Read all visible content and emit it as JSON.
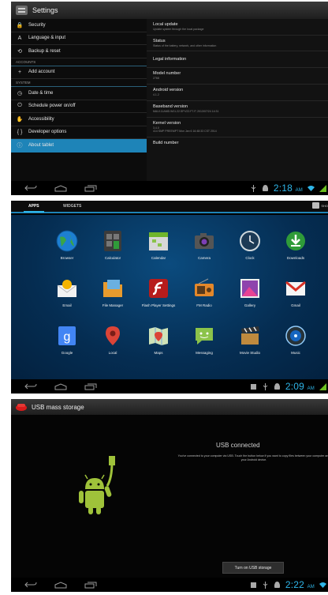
{
  "settings": {
    "title": "Settings",
    "left_items": [
      {
        "icon": "🔒",
        "label": "Security"
      },
      {
        "icon": "A",
        "label": "Language & input"
      },
      {
        "icon": "⟲",
        "label": "Backup & reset"
      }
    ],
    "accounts_header": "ACCOUNTS",
    "add_account": {
      "icon": "+",
      "label": "Add account"
    },
    "system_header": "SYSTEM",
    "system_items": [
      {
        "icon": "◷",
        "label": "Date & time"
      },
      {
        "icon": "⏻",
        "label": "Schedule power on/off"
      },
      {
        "icon": "✋",
        "label": "Accessibility"
      },
      {
        "icon": "{ }",
        "label": "Developer options"
      },
      {
        "icon": "ⓘ",
        "label": "About tablet"
      }
    ],
    "right_items": [
      {
        "title": "Local update",
        "sub": "Update system through the local package"
      },
      {
        "title": "Status",
        "sub": "Status of the battery, network, and other information"
      },
      {
        "title": "Legal information",
        "sub": ""
      },
      {
        "title": "Model number",
        "sub": "2768"
      },
      {
        "title": "Android version",
        "sub": "4.1.2"
      },
      {
        "title": "Baseband version",
        "sub": "MAUI.11AMD.W11.22.SP.V22.F7.P, 2013/07/24 14:31"
      },
      {
        "title": "Kernel version",
        "sub": "3.4.0\n414 SMP PREEMPT Mon Jan 6 16:48:33 CST 2014"
      },
      {
        "title": "Build number",
        "sub": ""
      }
    ],
    "clock": "2:18",
    "ampm": "AM"
  },
  "drawer": {
    "tabs": {
      "apps": "APPS",
      "widgets": "WIDGETS"
    },
    "shop_label": "SHO",
    "apps": [
      {
        "label": "Browser"
      },
      {
        "label": "Calculator"
      },
      {
        "label": "Calendar"
      },
      {
        "label": "Camera"
      },
      {
        "label": "Clock"
      },
      {
        "label": "Downloads"
      },
      {
        "label": "Email"
      },
      {
        "label": "File Manager"
      },
      {
        "label": "Flash Player Settings"
      },
      {
        "label": "FM Radio"
      },
      {
        "label": "Gallery"
      },
      {
        "label": "Gmail"
      },
      {
        "label": "Google"
      },
      {
        "label": "Local"
      },
      {
        "label": "Maps"
      },
      {
        "label": "Messaging"
      },
      {
        "label": "Movie Studio"
      },
      {
        "label": "Music"
      }
    ],
    "clock": "2:09",
    "ampm": "AM"
  },
  "usb": {
    "title": "USB mass storage",
    "heading": "USB connected",
    "description": "You've connected to your computer via USB. Touch the button below if you want to copy files between your computer and your Android device.",
    "button": "Turn on USB storage",
    "clock": "2:22",
    "ampm": "AM"
  },
  "colors": {
    "accent": "#1e84b8",
    "clock": "#2fb5e8",
    "android_green": "#9fc23a",
    "usb_red": "#d81b1b"
  }
}
